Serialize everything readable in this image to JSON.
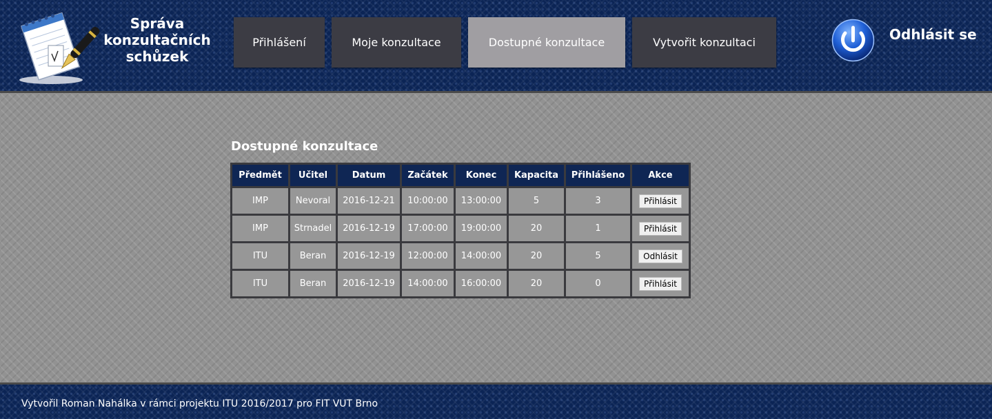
{
  "header": {
    "logo_title": "Správa konzultačních schůzek",
    "logo_icon": "notepad-pen-icon",
    "nav": [
      {
        "label": "Přihlášení",
        "active": false
      },
      {
        "label": "Moje konzultace",
        "active": false
      },
      {
        "label": "Dostupné konzultace",
        "active": true
      },
      {
        "label": "Vytvořit konzultaci",
        "active": false
      }
    ],
    "logout_icon": "power-icon",
    "logout_label": "Odhlásit se"
  },
  "main": {
    "title": "Dostupné konzultace",
    "table": {
      "columns": [
        "Předmět",
        "Učitel",
        "Datum",
        "Začátek",
        "Konec",
        "Kapacita",
        "Přihlášeno",
        "Akce"
      ],
      "rows": [
        {
          "subject": "IMP",
          "teacher": "Nevoral",
          "date": "2016-12-21",
          "start": "10:00:00",
          "end": "13:00:00",
          "capacity": "5",
          "registered": "3",
          "action": "Přihlásit"
        },
        {
          "subject": "IMP",
          "teacher": "Strnadel",
          "date": "2016-12-19",
          "start": "17:00:00",
          "end": "19:00:00",
          "capacity": "20",
          "registered": "1",
          "action": "Přihlásit"
        },
        {
          "subject": "ITU",
          "teacher": "Beran",
          "date": "2016-12-19",
          "start": "12:00:00",
          "end": "14:00:00",
          "capacity": "20",
          "registered": "5",
          "action": "Odhlásit"
        },
        {
          "subject": "ITU",
          "teacher": "Beran",
          "date": "2016-12-19",
          "start": "14:00:00",
          "end": "16:00:00",
          "capacity": "20",
          "registered": "0",
          "action": "Přihlásit"
        }
      ]
    }
  },
  "footer": {
    "text": "Vytvořil Roman Nahálka v rámci projektu ITU 2016/2017 pro FIT VUT Brno"
  },
  "colors": {
    "header_bg": "#0b2455",
    "nav_bg": "#3c3c44",
    "nav_active_bg": "#a09ea2",
    "table_header_bg": "#0f2654",
    "table_cell_bg": "#979797"
  }
}
